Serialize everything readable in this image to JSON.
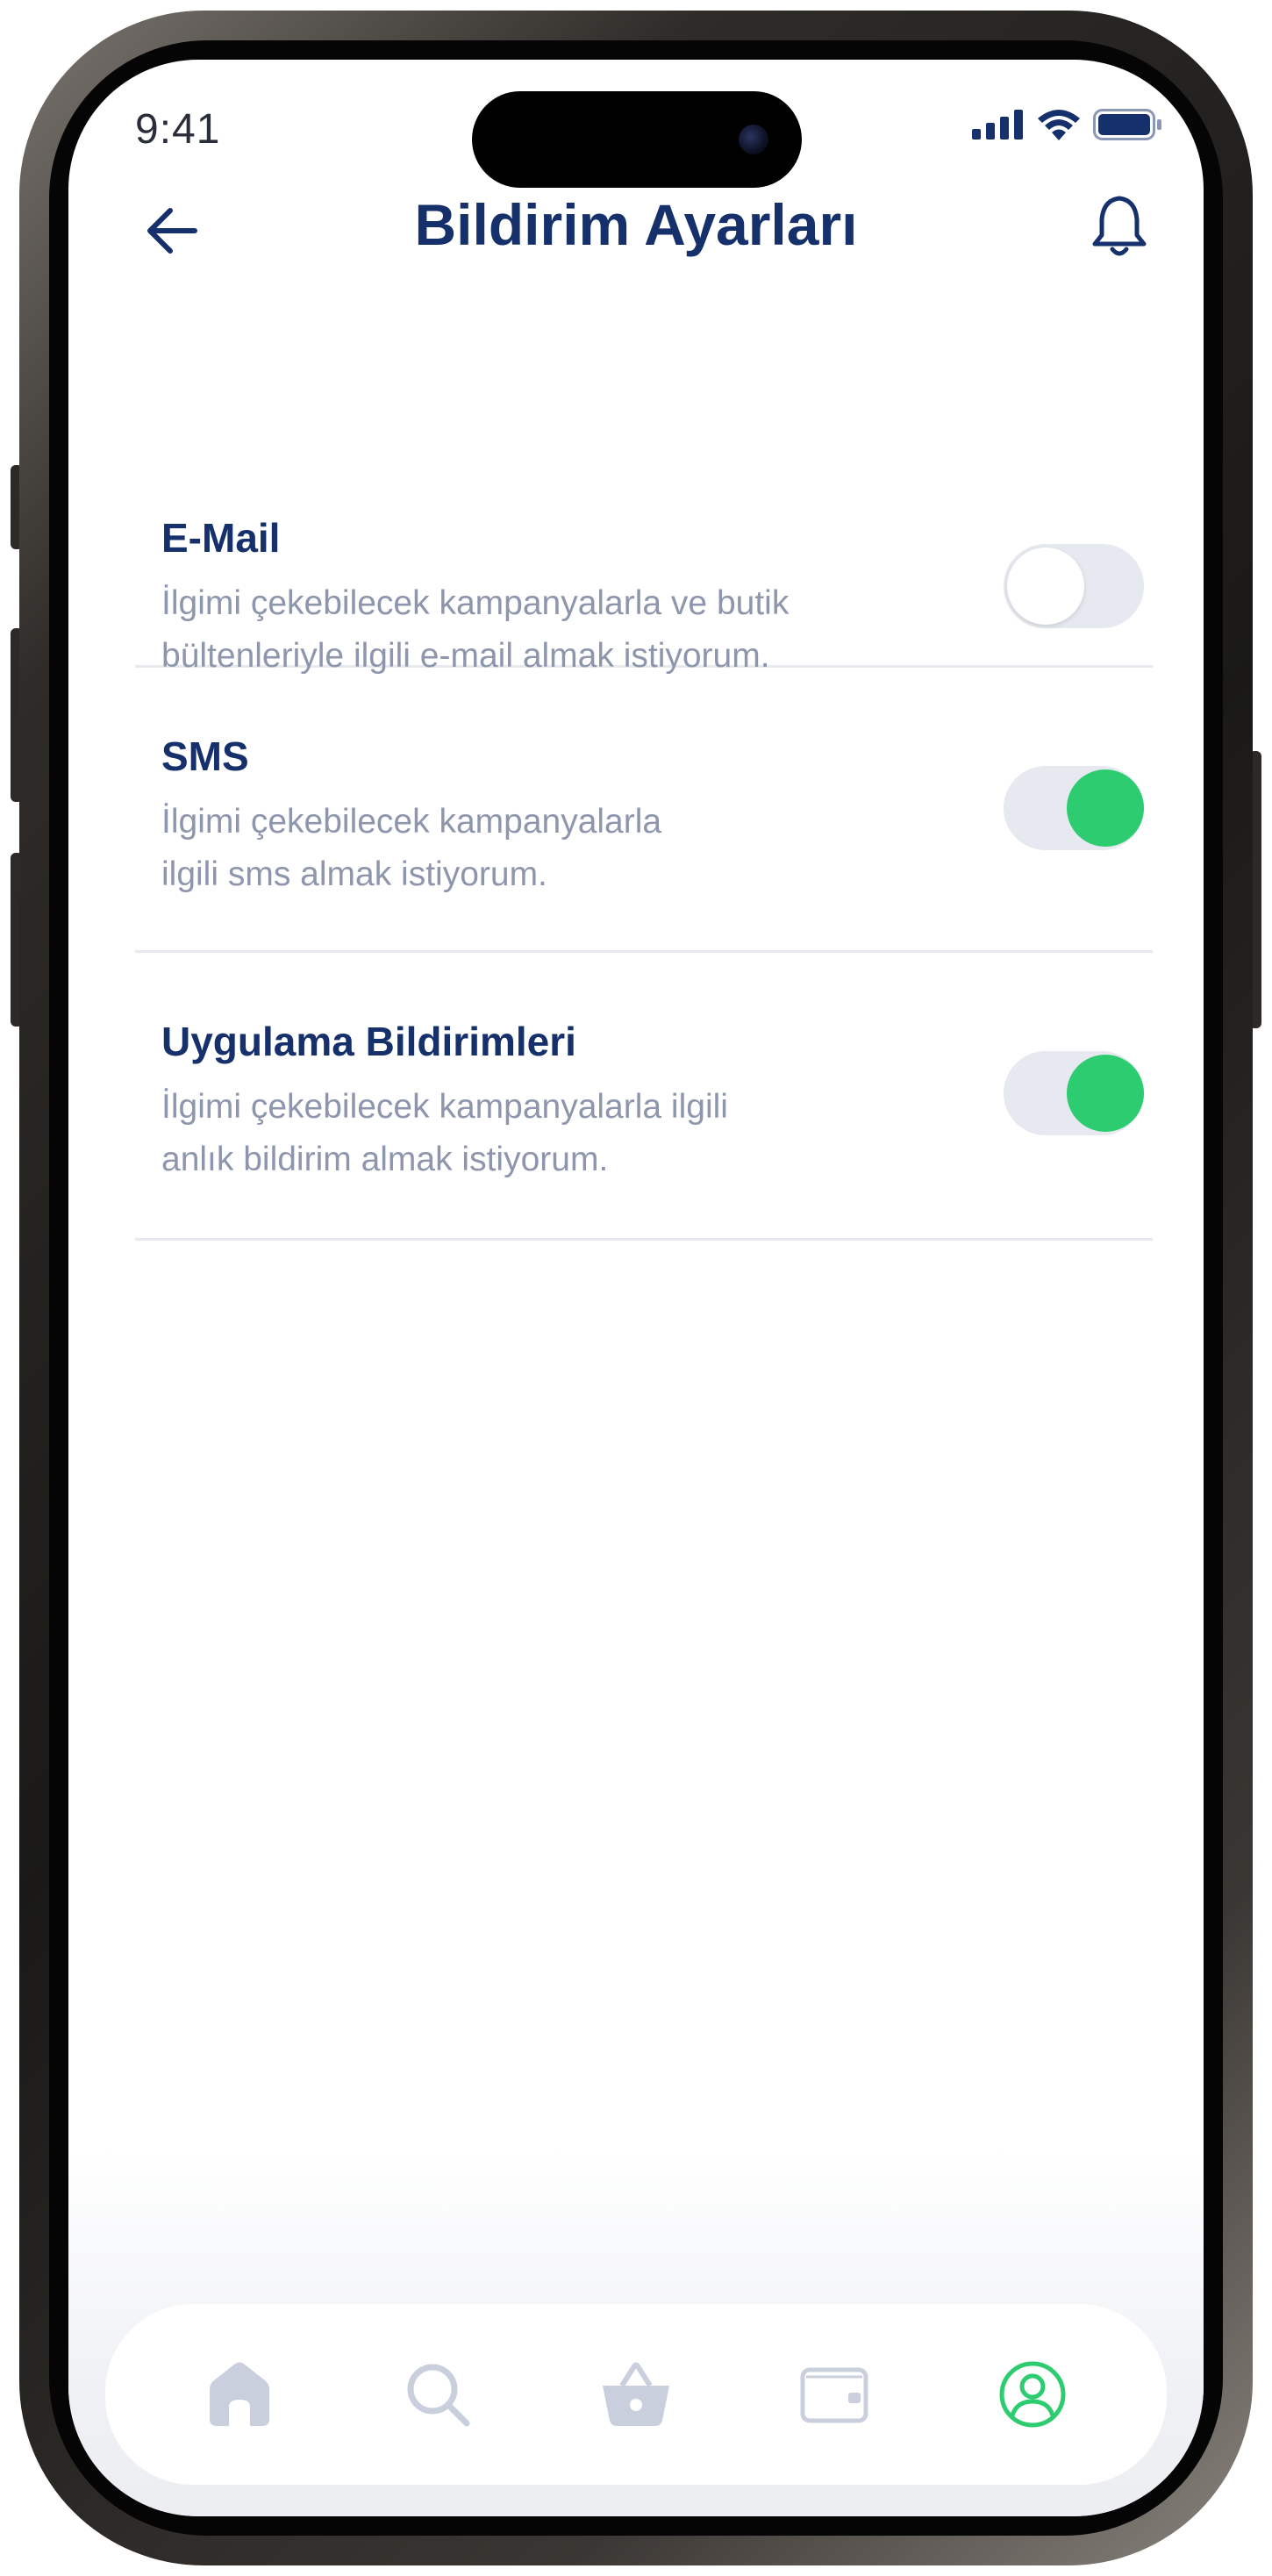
{
  "status_bar": {
    "time": "9:41"
  },
  "header": {
    "title": "Bildirim Ayarları"
  },
  "settings": [
    {
      "title": "E-Mail",
      "desc_line1": "İlgimi çekebilecek kampanyalarla ve butik",
      "desc_line2": "bültenleriyle ilgili e-mail almak istiyorum.",
      "enabled": false
    },
    {
      "title": "SMS",
      "desc_line1": "İlgimi çekebilecek kampanyalarla",
      "desc_line2": "ilgili sms almak istiyorum.",
      "enabled": true
    },
    {
      "title": "Uygulama Bildirimleri",
      "desc_line1": "İlgimi çekebilecek kampanyalarla ilgili",
      "desc_line2": "anlık bildirim almak istiyorum.",
      "enabled": true
    }
  ],
  "bottom_nav": {
    "items": [
      {
        "icon": "home-icon",
        "active": false
      },
      {
        "icon": "search-icon",
        "active": false
      },
      {
        "icon": "basket-icon",
        "active": false
      },
      {
        "icon": "wallet-icon",
        "active": false
      },
      {
        "icon": "profile-icon",
        "active": true
      }
    ]
  },
  "colors": {
    "primary": "#15306b",
    "secondary_text": "#8d96ac",
    "toggle_on": "#2ecc71",
    "toggle_track": "#e6e9f0",
    "nav_inactive": "#c9cfdc",
    "nav_active": "#2ecc71"
  }
}
